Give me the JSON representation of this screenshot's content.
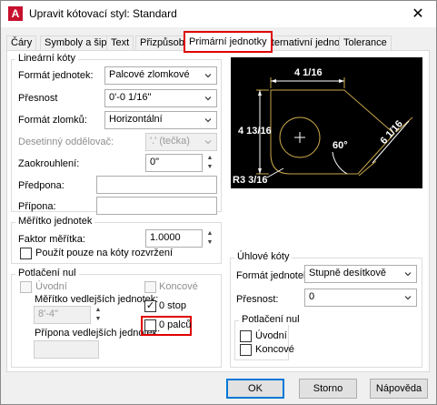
{
  "window": {
    "title": "Upravit kótovací styl: Standard",
    "close": "✕"
  },
  "tabs": [
    "Čáry",
    "Symboly a šipky",
    "Text",
    "Přizpůsobit",
    "Primární jednotky",
    "Alternativní jednotky",
    "Tolerance"
  ],
  "linear": {
    "group": "Lineární kóty",
    "unit_format_label": "Formát jednotek:",
    "unit_format_value": "Palcové zlomkové",
    "precision_label": "Přesnost",
    "precision_value": "0'-0 1/16\"",
    "fraction_format_label": "Formát zlomků:",
    "fraction_format_value": "Horizontální",
    "decimal_sep_label": "Desetinný oddělovač:",
    "decimal_sep_value": "'.' (tečka)",
    "round_off_label": "Zaokrouhlení:",
    "round_off_value": "0\"",
    "prefix_label": "Předpona:",
    "prefix_value": "",
    "suffix_label": "Přípona:",
    "suffix_value": ""
  },
  "scale": {
    "group": "Měřítko jednotek",
    "factor_label": "Faktor měřítka:",
    "factor_value": "1.0000",
    "layout_only_label": "Použít pouze na kóty rozvržení"
  },
  "zero_sup": {
    "group": "Potlačení nul",
    "leading_label": "Úvodní",
    "trailing_label": "Koncové",
    "sub_factor_label": "Měřítko vedlejších jednotek:",
    "sub_factor_value": "8'-4\"",
    "sub_suffix_label": "Přípona vedlejších jednotek:",
    "sub_suffix_value": "",
    "feet_label": "0 stop",
    "inches_label": "0 palců",
    "feet_checked": "✓",
    "inches_checked": ""
  },
  "angular": {
    "group": "Úhlové kóty",
    "unit_format_label": "Formát jednotek:",
    "unit_format_value": "Stupně desítkově",
    "precision_label": "Přesnost:",
    "precision_value": "0",
    "zero_group": "Potlačení nul",
    "leading_label": "Úvodní",
    "trailing_label": "Koncové"
  },
  "preview": {
    "dim_top": "4 1/16",
    "dim_left": "4 13/16",
    "dim_right": "6 1/16",
    "dim_angle": "60°",
    "dim_radius": "R3 3/16"
  },
  "buttons": {
    "ok": "OK",
    "cancel": "Storno",
    "help": "Nápověda"
  },
  "colors": {
    "highlight": "#e00000",
    "preview_line": "#c8a64a",
    "accent": "#0078d7"
  }
}
